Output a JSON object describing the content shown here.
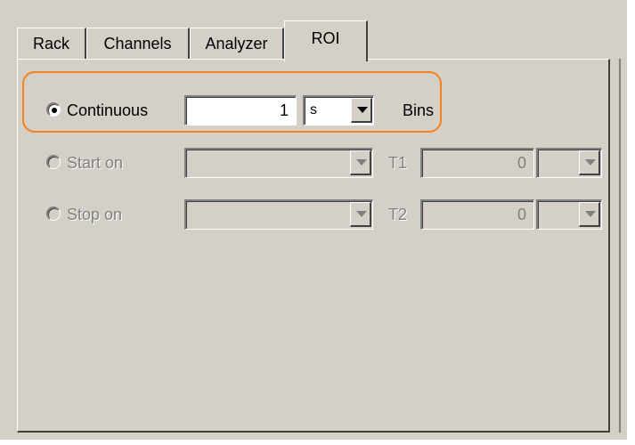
{
  "tabs": [
    {
      "label": "Rack"
    },
    {
      "label": "Channels"
    },
    {
      "label": "Analyzer"
    },
    {
      "label": "ROI",
      "active": true
    }
  ],
  "continuous": {
    "label": "Continuous",
    "selected": true,
    "value": "1",
    "unit": "s",
    "suffix": "Bins"
  },
  "start_on": {
    "label": "Start on",
    "selected": false,
    "enabled": false,
    "combo_value": "",
    "t_label": "T1",
    "t_value": "0",
    "t_unit": ""
  },
  "stop_on": {
    "label": "Stop on",
    "selected": false,
    "enabled": false,
    "combo_value": "",
    "t_label": "T2",
    "t_value": "0",
    "t_unit": ""
  },
  "colors": {
    "dialog_bg": "#d4d0c8",
    "highlight": "#f7811f",
    "disabled_text": "#808080"
  },
  "icons": [
    "radio-selected-icon",
    "radio-unselected-icon",
    "dropdown-arrow-icon"
  ]
}
